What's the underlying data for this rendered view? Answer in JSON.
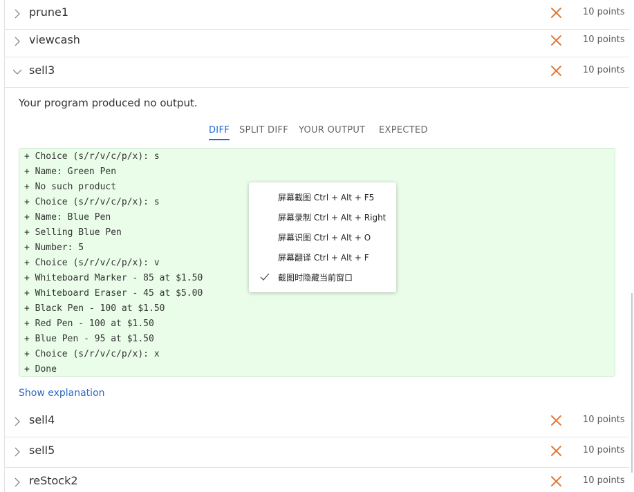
{
  "tests_top": [
    {
      "name": "prune1",
      "points": "10 points",
      "expanded": false
    },
    {
      "name": "viewcash",
      "points": "10 points",
      "expanded": false
    },
    {
      "name": "sell3",
      "points": "10 points",
      "expanded": true
    }
  ],
  "tests_bottom": [
    {
      "name": "sell4",
      "points": "10 points",
      "expanded": false
    },
    {
      "name": "sell5",
      "points": "10 points",
      "expanded": false
    },
    {
      "name": "reStock2",
      "points": "10 points",
      "expanded": false
    }
  ],
  "expanded": {
    "message": "Your program produced no output.",
    "tabs": [
      "DIFF",
      "SPLIT DIFF",
      "YOUR OUTPUT",
      "EXPECTED"
    ],
    "active_tab": "DIFF",
    "diff_lines": [
      "+ Choice (s/r/v/c/p/x): s",
      "+ Name: Green Pen",
      "+ No such product",
      "+ Choice (s/r/v/c/p/x): s",
      "+ Name: Blue Pen",
      "+ Selling Blue Pen",
      "+ Number: 5",
      "+ Choice (s/r/v/c/p/x): v",
      "+ Whiteboard Marker - 85 at $1.50",
      "+ Whiteboard Eraser - 45 at $5.00",
      "+ Black Pen - 100 at $1.50",
      "+ Red Pen - 100 at $1.50",
      "+ Blue Pen - 95 at $1.50",
      "+ Choice (s/r/v/c/p/x): x",
      "+ Done"
    ],
    "show_explanation": "Show explanation"
  },
  "context_menu": {
    "items": [
      {
        "label": "屏幕截图 Ctrl + Alt + F5",
        "checked": false
      },
      {
        "label": "屏幕录制 Ctrl + Alt + Right",
        "checked": false
      },
      {
        "label": "屏幕识图 Ctrl + Alt + O",
        "checked": false
      },
      {
        "label": "屏幕翻译 Ctrl + Alt + F",
        "checked": false
      },
      {
        "label": "截图时隐藏当前窗口",
        "checked": true
      }
    ]
  },
  "colors": {
    "fail_x": "#e07b39",
    "accent": "#1e6bd6",
    "link": "#2a68c4",
    "diff_bg": "#e9fde9"
  },
  "icons": {
    "collapsed": "chevron-right-icon",
    "expanded": "chevron-down-icon",
    "fail": "close-icon",
    "check": "checkmark-icon"
  }
}
